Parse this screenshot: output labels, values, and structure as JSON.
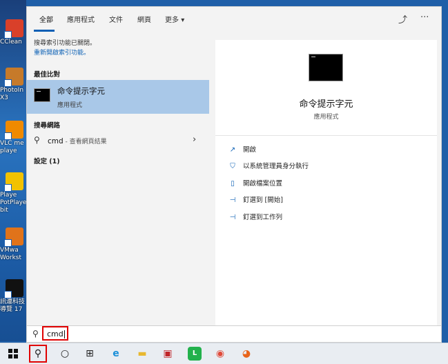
{
  "desktop": {
    "icons": [
      {
        "label": "CClean",
        "color": "#d9402a"
      },
      {
        "label": "PhotoIn\nX3",
        "color": "#c67a2a"
      },
      {
        "label": "VLC me\nplaye",
        "color": "#f08a00"
      },
      {
        "label": "Playe\nPotPlaye\nbit",
        "color": "#f2c200"
      },
      {
        "label": "VMwa\nWorkst",
        "color": "#e0731a"
      },
      {
        "label": "訊連科技\n導覽 17",
        "color": "#111111"
      }
    ]
  },
  "tabs": {
    "all": "全部",
    "apps": "應用程式",
    "documents": "文件",
    "web": "網頁",
    "more": "更多",
    "more_chevron": "▾"
  },
  "header_icons": {
    "feedback": "⤴",
    "menu": "···"
  },
  "indexing": {
    "message": "搜尋索引功能已關閉。",
    "link": "重新開啟索引功能。"
  },
  "sections": {
    "best_match": "最佳比對",
    "web_search": "搜尋網路",
    "settings": "設定 (1)"
  },
  "best_match": {
    "name": "命令提示字元",
    "type": "應用程式"
  },
  "web_result": {
    "query": "cmd",
    "suffix": " - 查看網頁結果"
  },
  "detail": {
    "title": "命令提示字元",
    "subtitle": "應用程式",
    "actions": [
      {
        "icon": "open-icon",
        "glyph": "↗",
        "label": "開啟"
      },
      {
        "icon": "shield-icon",
        "glyph": "⛉",
        "label": "以系統管理員身分執行"
      },
      {
        "icon": "folder-icon",
        "glyph": "▯",
        "label": "開啟檔案位置"
      },
      {
        "icon": "pin-icon",
        "glyph": "⊣",
        "label": "釘選到 [開始]"
      },
      {
        "icon": "pin-icon",
        "glyph": "⊣",
        "label": "釘選到工作列"
      }
    ]
  },
  "search": {
    "query": "cmd"
  },
  "taskbar": {
    "items": [
      {
        "name": "task-view-icon",
        "glyph": "○"
      },
      {
        "name": "timeline-icon",
        "glyph": "⊞"
      },
      {
        "name": "edge-icon",
        "glyph": "e",
        "color": "#1a8fd8"
      },
      {
        "name": "file-explorer-icon",
        "glyph": "▬",
        "color": "#e8b830"
      },
      {
        "name": "app-icon",
        "glyph": "▣",
        "color": "#c0262a"
      },
      {
        "name": "line-icon",
        "glyph": "L",
        "color": "#22b14c"
      },
      {
        "name": "chrome-icon",
        "glyph": "◉",
        "color": "#e04a3a"
      },
      {
        "name": "firefox-icon",
        "glyph": "◕",
        "color": "#e8641a"
      }
    ]
  }
}
